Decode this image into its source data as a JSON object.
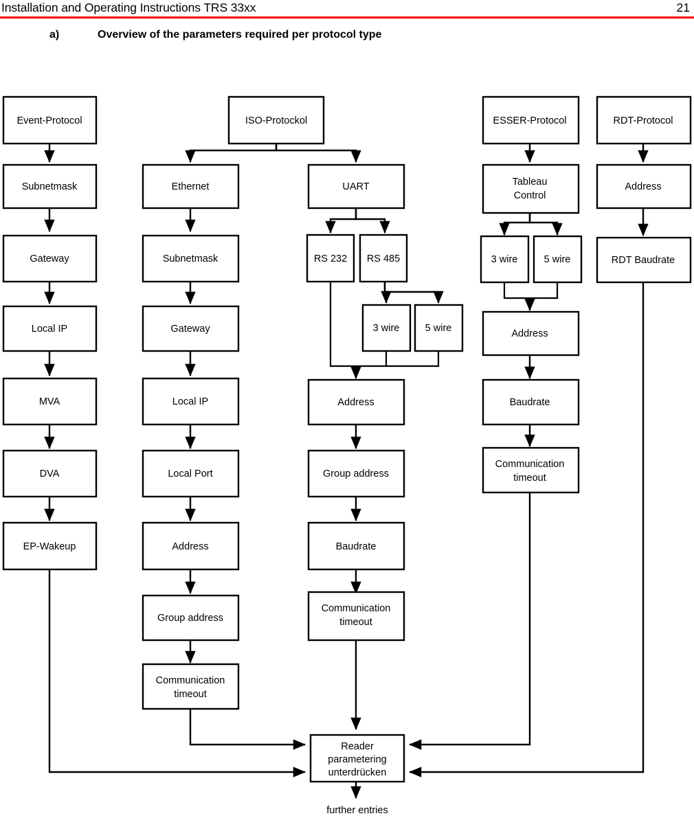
{
  "header": {
    "title": "Installation and Operating Instructions TRS 33xx",
    "page_number": "21",
    "rule_color": "#ff0000"
  },
  "section": {
    "letter": "a)",
    "title": "Overview of the parameters required per protocol type"
  },
  "diagram": {
    "type": "flowchart",
    "caption_below": "further entries",
    "converge_node": {
      "id": "reader",
      "lines": [
        "Reader",
        "parametering",
        "unterdrücken"
      ]
    },
    "columns": [
      {
        "id": "event-protocol",
        "root": "Event-Protocol",
        "nodes": [
          "Event-Protocol",
          "Subnetmask",
          "Gateway",
          "Local IP",
          "MVA",
          "DVA",
          "EP-Wakeup"
        ]
      },
      {
        "id": "iso-protocol",
        "root": "ISO-Protockol",
        "branches": [
          {
            "id": "ethernet",
            "nodes": [
              "Ethernet",
              "Subnetmask",
              "Gateway",
              "Local IP",
              "Local Port",
              "Address",
              "Group address",
              "Communication timeout"
            ]
          },
          {
            "id": "uart",
            "nodes": [
              "UART",
              "RS 232",
              "RS 485",
              "3 wire",
              "5 wire",
              "Address",
              "Group address",
              "Baudrate",
              "Communication timeout"
            ]
          }
        ]
      },
      {
        "id": "esser-protocol",
        "root": "ESSER-Protocol",
        "nodes": [
          "ESSER-Protocol",
          "Tableau Control",
          "3 wire",
          "5 wire",
          "Address",
          "Baudrate",
          "Communication timeout"
        ]
      },
      {
        "id": "rdt-protocol",
        "root": "RDT-Protocol",
        "nodes": [
          "RDT-Protocol",
          "Address",
          "RDT Baudrate"
        ]
      }
    ],
    "labels": {
      "event_protocol": "Event-Protocol",
      "subnetmask": "Subnetmask",
      "gateway": "Gateway",
      "local_ip": "Local IP",
      "mva": "MVA",
      "dva": "DVA",
      "ep_wakeup": "EP-Wakeup",
      "iso_protocol": "ISO-Protockol",
      "ethernet": "Ethernet",
      "eth_subnetmask": "Subnetmask",
      "eth_gateway": "Gateway",
      "eth_local_ip": "Local IP",
      "eth_local_port": "Local Port",
      "eth_address": "Address",
      "eth_group_address": "Group address",
      "eth_comm_1": "Communication",
      "eth_comm_2": "timeout",
      "uart": "UART",
      "rs232": "RS 232",
      "rs485": "RS 485",
      "uart_3wire": "3 wire",
      "uart_5wire": "5 wire",
      "uart_address": "Address",
      "uart_group_address": "Group address",
      "uart_baudrate": "Baudrate",
      "uart_comm_1": "Communication",
      "uart_comm_2": "timeout",
      "esser_protocol": "ESSER-Protocol",
      "tableau_1": "Tableau",
      "tableau_2": "Control",
      "esser_3wire": "3 wire",
      "esser_5wire": "5 wire",
      "esser_address": "Address",
      "esser_baudrate": "Baudrate",
      "esser_comm_1": "Communication",
      "esser_comm_2": "timeout",
      "rdt_protocol": "RDT-Protocol",
      "rdt_address": "Address",
      "rdt_baudrate": "RDT Baudrate",
      "reader_1": "Reader",
      "reader_2": "parametering",
      "reader_3": "unterdrücken",
      "further_entries": "further entries"
    }
  }
}
